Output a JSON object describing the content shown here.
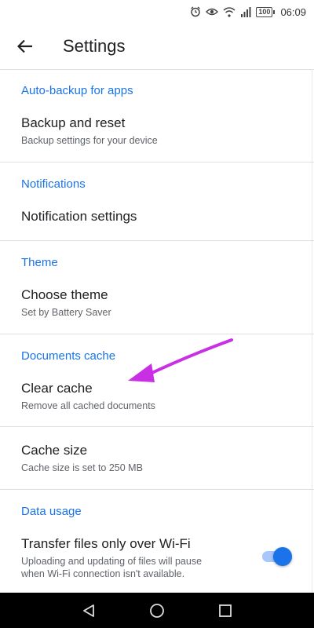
{
  "status_bar": {
    "battery": "100",
    "time": "06:09"
  },
  "app_bar": {
    "title": "Settings",
    "back_icon": "arrow-back-icon"
  },
  "sections": [
    {
      "header": "Auto-backup for apps",
      "items": [
        {
          "title": "Backup and reset",
          "subtitle": "Backup settings for your device"
        }
      ]
    },
    {
      "header": "Notifications",
      "items": [
        {
          "title": "Notification settings"
        }
      ]
    },
    {
      "header": "Theme",
      "items": [
        {
          "title": "Choose theme",
          "subtitle": "Set by Battery Saver"
        }
      ]
    },
    {
      "header": "Documents cache",
      "items": [
        {
          "title": "Clear cache",
          "subtitle": "Remove all cached documents"
        },
        {
          "title": "Cache size",
          "subtitle": "Cache size is set to 250 MB"
        }
      ]
    },
    {
      "header": "Data usage",
      "items": [
        {
          "title": "Transfer files only over Wi-Fi",
          "subtitle_lines": [
            "Uploading and updating of files will pause",
            "when Wi-Fi connection isn't available."
          ],
          "toggle_on": true
        }
      ]
    }
  ],
  "colors": {
    "accent": "#1a73e8",
    "annotation": "#c930e6"
  },
  "nav_bar": {
    "icons": [
      "back-triangle-icon",
      "home-circle-icon",
      "recents-square-icon"
    ]
  }
}
